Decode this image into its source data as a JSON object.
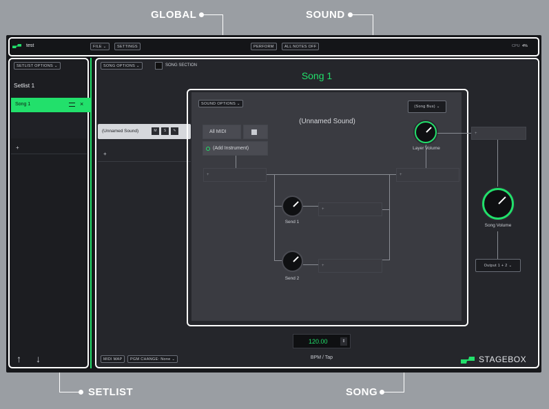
{
  "callouts": {
    "global": "GLOBAL",
    "sound": "SOUND",
    "setlist": "SETLIST",
    "song": "SONG"
  },
  "topbar": {
    "project_name": "test",
    "file_label": "FILE ⌄",
    "settings_label": "SETTINGS",
    "perform_label": "PERFORM",
    "all_notes_off_label": "ALL NOTES OFF",
    "cpu_label": "CPU",
    "cpu_value": "4%"
  },
  "setlist": {
    "options_label": "SETLIST OPTIONS ⌄",
    "title": "Setlist 1",
    "songs": [
      {
        "name": "Song 1",
        "selected": true
      }
    ],
    "add_label": "+",
    "up_icon": "arrow-up-icon",
    "down_icon": "arrow-down-icon"
  },
  "song": {
    "options_label": "SONG OPTIONS ⌄",
    "section_label": "SONG SECTION",
    "title": "Song 1",
    "sound_name": "(Unnamed Sound)",
    "sound_buttons": [
      "M",
      "S",
      "✎"
    ],
    "add_label": "+",
    "volume_label": "Song Volume",
    "output_label": "Output 1 + 2 ⌄",
    "tempo_value": "120.00",
    "tempo_label": "BPM / Tap",
    "midi_map_label": "MIDI MAP",
    "pgm_change_label": "PGM CHANGE: None ⌄",
    "brand": "STAGEBOX"
  },
  "sound": {
    "options_label": "SOUND OPTIONS ⌄",
    "bus_label": "(Song Bus) ⌄",
    "title": "(Unnamed Sound)",
    "midi_label": "All MIDI",
    "add_instrument_label": "(Add Instrument)",
    "layer_volume_label": "Layer Volume",
    "send1_label": "Send 1",
    "send2_label": "Send 2",
    "slot_plus": "+"
  },
  "colors": {
    "accent": "#22e06b",
    "background": "#17181b"
  }
}
